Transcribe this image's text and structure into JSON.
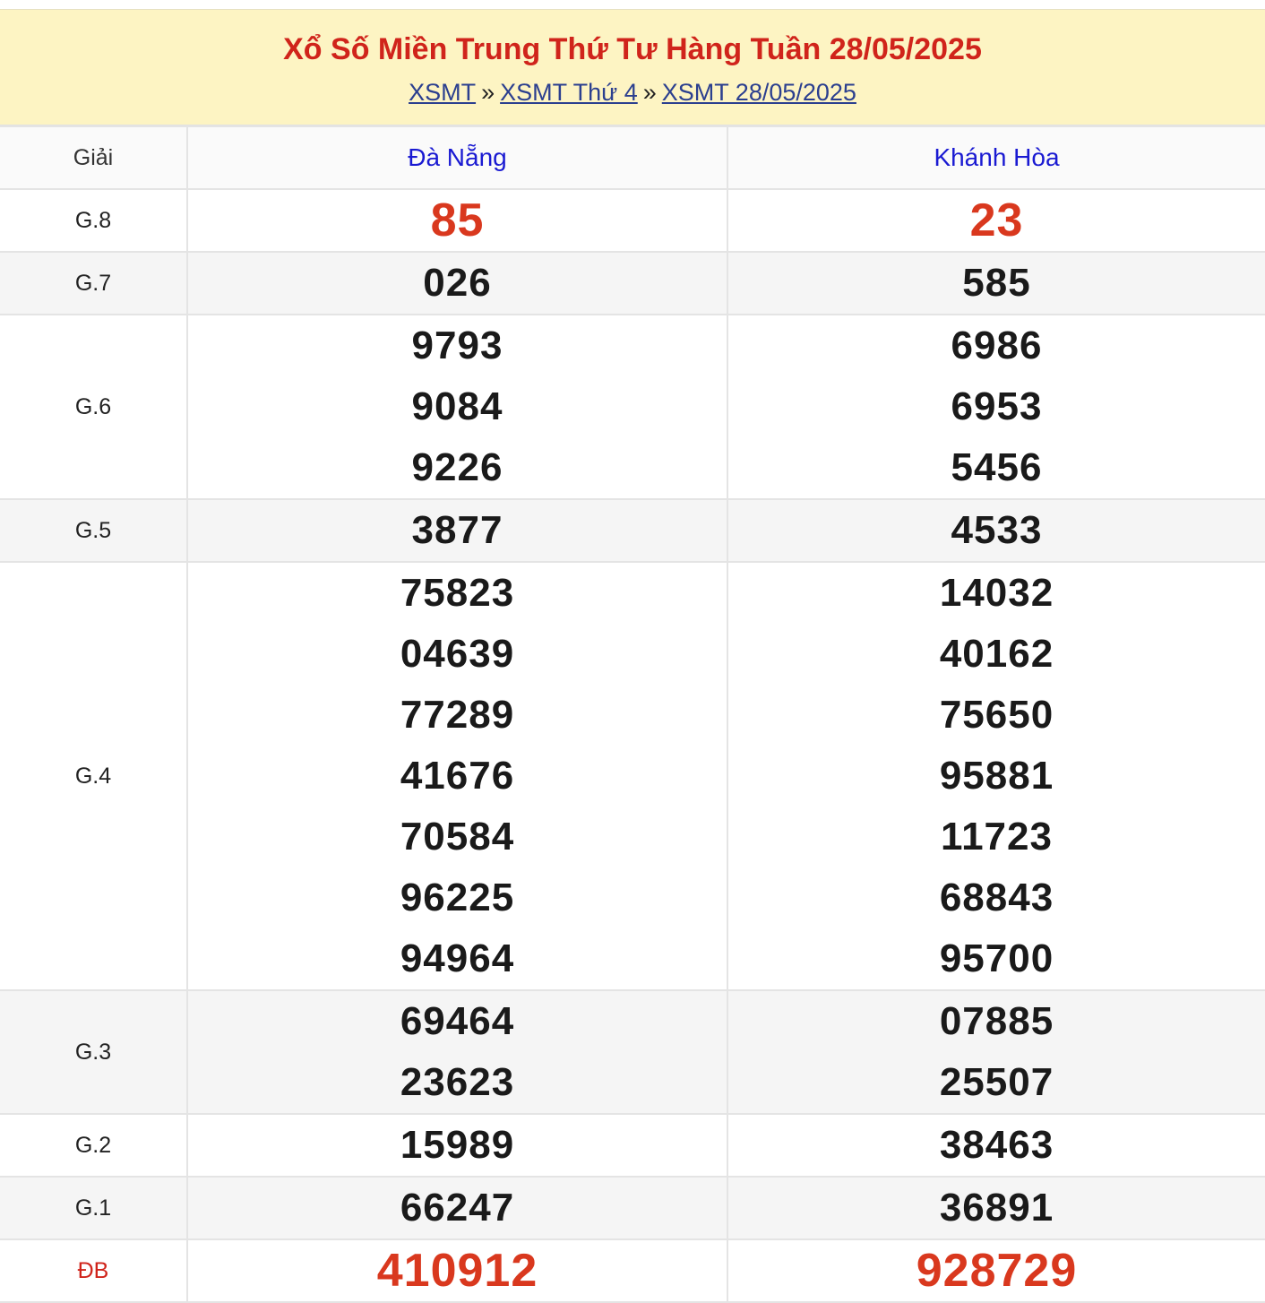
{
  "header": {
    "title": "Xổ Số Miền Trung Thứ Tư Hàng Tuần 28/05/2025",
    "breadcrumb": [
      {
        "label": "XSMT"
      },
      {
        "label": "XSMT Thứ 4"
      },
      {
        "label": "XSMT 28/05/2025"
      }
    ],
    "separator": "»"
  },
  "table": {
    "prize_header": "Giải",
    "provinces": [
      "Đà Nẵng",
      "Khánh Hòa"
    ],
    "rows": [
      {
        "prize": "G.8",
        "values": [
          [
            "85"
          ],
          [
            "23"
          ]
        ],
        "highlight": true
      },
      {
        "prize": "G.7",
        "values": [
          [
            "026"
          ],
          [
            "585"
          ]
        ]
      },
      {
        "prize": "G.6",
        "values": [
          [
            "9793",
            "9084",
            "9226"
          ],
          [
            "6986",
            "6953",
            "5456"
          ]
        ]
      },
      {
        "prize": "G.5",
        "values": [
          [
            "3877"
          ],
          [
            "4533"
          ]
        ]
      },
      {
        "prize": "G.4",
        "values": [
          [
            "75823",
            "04639",
            "77289",
            "41676",
            "70584",
            "96225",
            "94964"
          ],
          [
            "14032",
            "40162",
            "75650",
            "95881",
            "11723",
            "68843",
            "95700"
          ]
        ]
      },
      {
        "prize": "G.3",
        "values": [
          [
            "69464",
            "23623"
          ],
          [
            "07885",
            "25507"
          ]
        ]
      },
      {
        "prize": "G.2",
        "values": [
          [
            "15989"
          ],
          [
            "38463"
          ]
        ]
      },
      {
        "prize": "G.1",
        "values": [
          [
            "66247"
          ],
          [
            "36891"
          ]
        ]
      },
      {
        "prize": "ĐB",
        "values": [
          [
            "410912"
          ],
          [
            "928729"
          ]
        ],
        "highlight": true,
        "special": true
      }
    ]
  }
}
